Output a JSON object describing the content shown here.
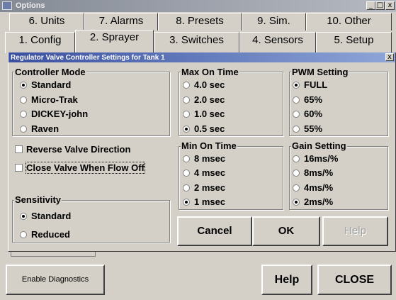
{
  "window": {
    "title": "Options",
    "min_glyph": "_",
    "max_glyph": "□",
    "close_glyph": "x"
  },
  "tabs_row1": [
    "6. Units",
    "7. Alarms",
    "8. Presets",
    "9. Sim.",
    "10. Other"
  ],
  "tabs_row2": [
    "1. Config",
    "2. Sprayer",
    "3. Switches",
    "4. Sensors",
    "5. Setup"
  ],
  "dialog": {
    "title": "Regulator Valve Controller Settings for Tank 1",
    "close_glyph": "x",
    "controller_mode": {
      "label": "Controller Mode",
      "options": [
        "Standard",
        "Micro-Trak",
        "DICKEY-john",
        "Raven"
      ],
      "selected": 0
    },
    "reverse_valve": "Reverse Valve Direction",
    "close_valve": "Close Valve When Flow Off",
    "sensitivity": {
      "label": "Sensitivity",
      "options": [
        "Standard",
        "Reduced"
      ],
      "selected": 0
    },
    "max_on_time": {
      "label": "Max On Time",
      "options": [
        "4.0 sec",
        "2.0 sec",
        "1.0 sec",
        "0.5 sec"
      ],
      "selected": 3
    },
    "min_on_time": {
      "label": "Min On Time",
      "options": [
        "8 msec",
        "4 msec",
        "2 msec",
        "1 msec"
      ],
      "selected": 3
    },
    "pwm_setting": {
      "label": "PWM Setting",
      "options": [
        "FULL",
        "65%",
        "60%",
        "55%"
      ],
      "selected": 0
    },
    "gain_setting": {
      "label": "Gain Setting",
      "options": [
        "16ms/%",
        "8ms/%",
        "4ms/%",
        "2ms/%"
      ],
      "selected": 3
    },
    "buttons": {
      "cancel": "Cancel",
      "ok": "OK",
      "help": "Help"
    }
  },
  "footer": {
    "diagnostics": "Enable Diagnostics",
    "help": "Help",
    "close": "CLOSE"
  }
}
